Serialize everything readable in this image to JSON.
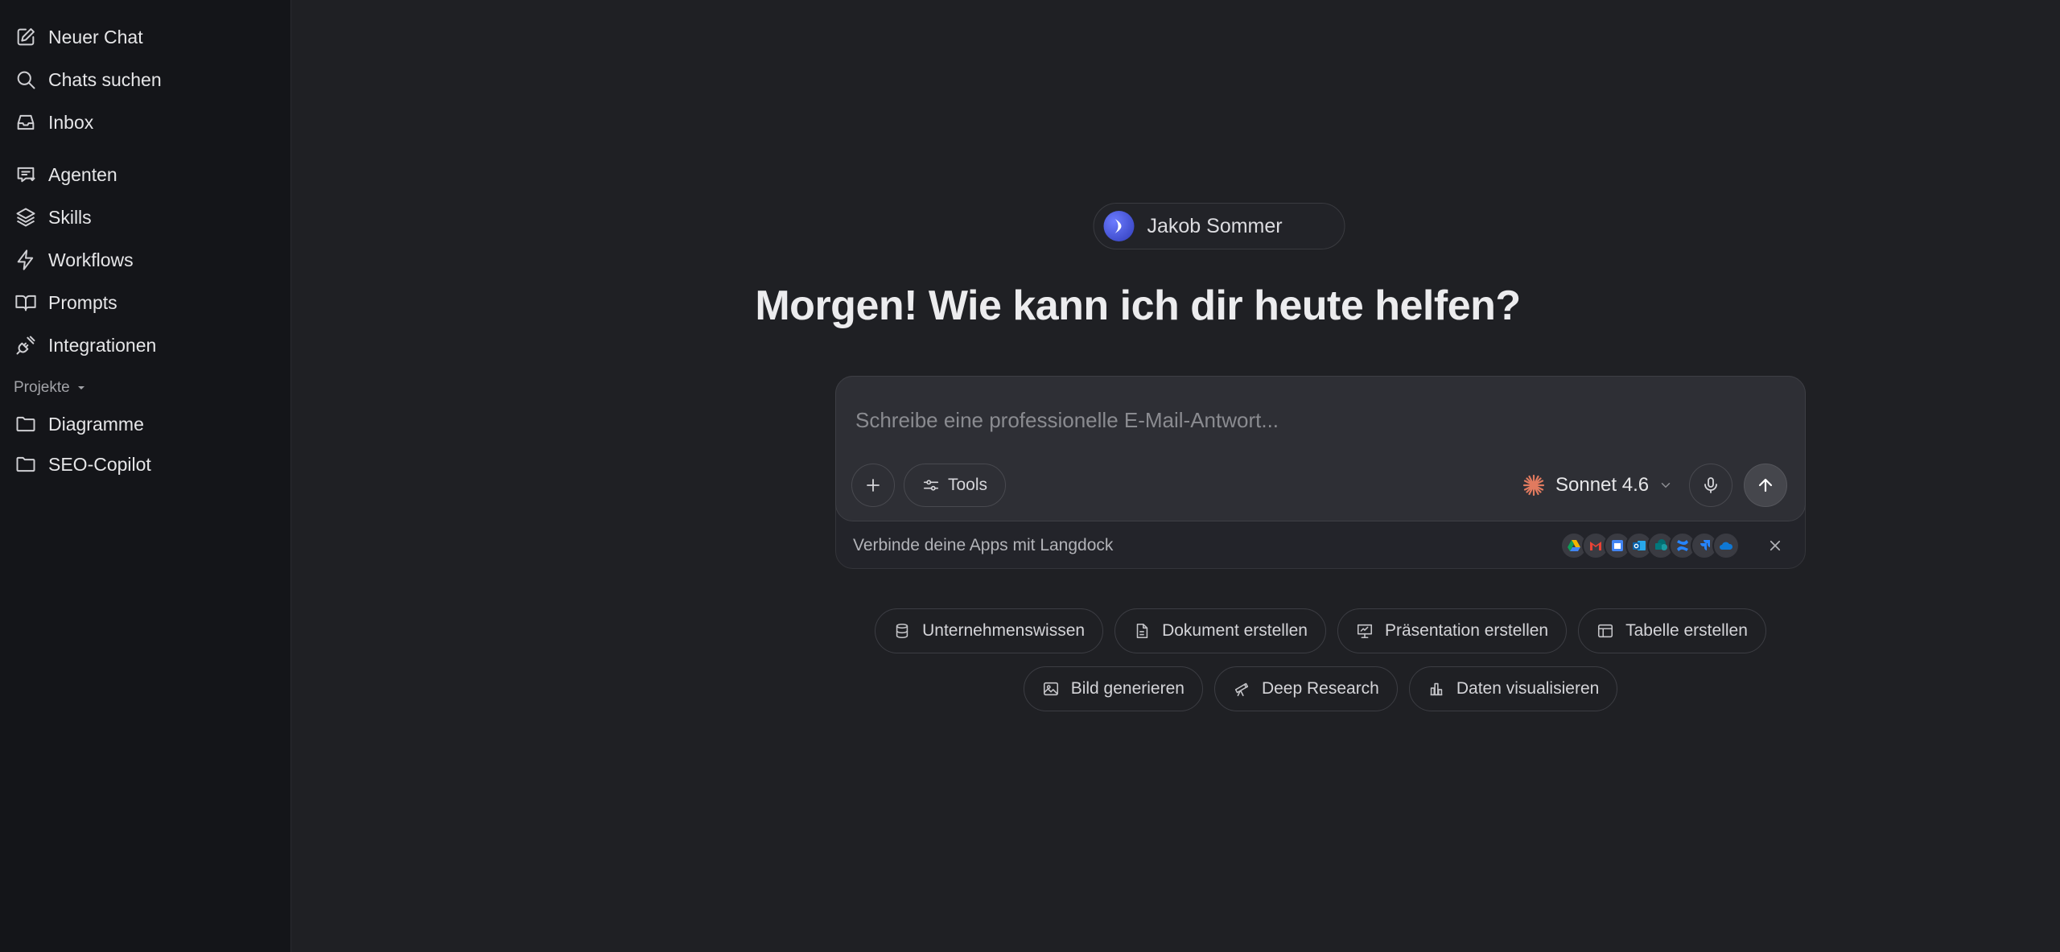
{
  "sidebar": {
    "nav": [
      {
        "label": "Neuer Chat",
        "icon": "edit-icon"
      },
      {
        "label": "Chats suchen",
        "icon": "search-icon"
      },
      {
        "label": "Inbox",
        "icon": "inbox-icon"
      },
      {
        "label": "Agenten",
        "icon": "agent-icon"
      },
      {
        "label": "Skills",
        "icon": "layers-icon"
      },
      {
        "label": "Workflows",
        "icon": "lightning-icon"
      },
      {
        "label": "Prompts",
        "icon": "book-icon"
      },
      {
        "label": "Integrationen",
        "icon": "plug-icon"
      }
    ],
    "projects_label": "Projekte",
    "projects": [
      {
        "label": "Diagramme",
        "icon": "folder-icon"
      },
      {
        "label": "SEO-Copilot",
        "icon": "folder-icon"
      }
    ]
  },
  "main": {
    "user_name": "Jakob Sommer",
    "greeting": "Morgen! Wie kann ich dir heute helfen?",
    "composer": {
      "placeholder": "Schreibe eine professionelle E-Mail-Antwort...",
      "value": "",
      "tools_label": "Tools",
      "model": "Sonnet 4.6"
    },
    "connect": {
      "label": "Verbinde deine Apps mit Langdock",
      "apps": [
        "google-drive-icon",
        "gmail-icon",
        "google-calendar-icon",
        "outlook-icon",
        "sharepoint-icon",
        "confluence-icon",
        "jira-icon",
        "onedrive-icon"
      ]
    },
    "suggestions_row1": [
      {
        "label": "Unternehmenswissen",
        "icon": "database-icon"
      },
      {
        "label": "Dokument erstellen",
        "icon": "document-icon"
      },
      {
        "label": "Präsentation erstellen",
        "icon": "presentation-icon"
      },
      {
        "label": "Tabelle erstellen",
        "icon": "table-icon"
      }
    ],
    "suggestions_row2": [
      {
        "label": "Bild generieren",
        "icon": "image-icon"
      },
      {
        "label": "Deep Research",
        "icon": "telescope-icon"
      },
      {
        "label": "Daten visualisieren",
        "icon": "bar-chart-icon"
      }
    ]
  },
  "colors": {
    "background": "#1f2024",
    "sidebar": "#141519",
    "composer": "#2e2f35",
    "accent_spark": "#e07a5f"
  }
}
